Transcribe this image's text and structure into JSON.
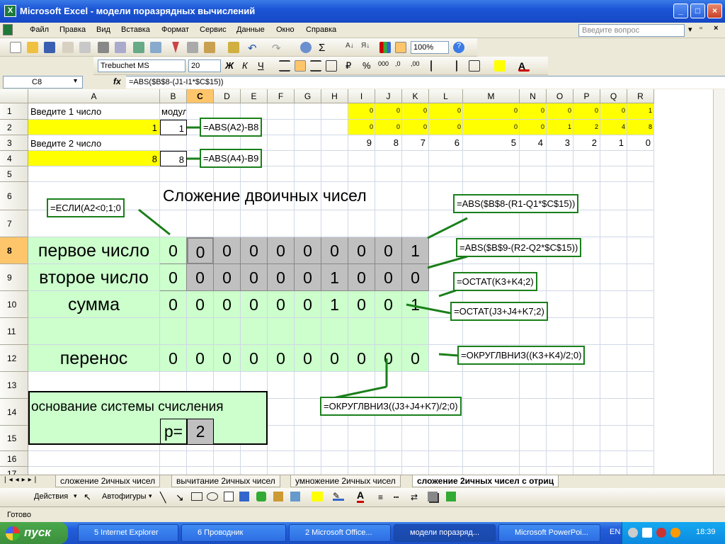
{
  "window": {
    "title": "Microsoft Excel - модели поразрядных вычислений"
  },
  "menu": {
    "items": [
      "Файл",
      "Правка",
      "Вид",
      "Вставка",
      "Формат",
      "Сервис",
      "Данные",
      "Окно",
      "Справка"
    ],
    "help_placeholder": "Введите вопрос"
  },
  "toolbar": {
    "zoom": "100%",
    "font_name": "Trebuchet MS",
    "font_size": "20"
  },
  "formula_bar": {
    "name_box": "C8",
    "fx": "fx",
    "formula": "=ABS($B$8-(J1-I1*$C$15))"
  },
  "columns": [
    "A",
    "B",
    "C",
    "D",
    "E",
    "F",
    "G",
    "H",
    "I",
    "J",
    "K",
    "L",
    "M",
    "N",
    "O",
    "P",
    "Q",
    "R"
  ],
  "rows": [
    "1",
    "2",
    "3",
    "4",
    "5",
    "6",
    "7",
    "8",
    "9",
    "10",
    "11",
    "12",
    "13",
    "14",
    "15",
    "16",
    "17"
  ],
  "cells": {
    "a1": "Введите 1 число",
    "b1": "модуль",
    "a2": "1",
    "b2": "1",
    "a3": "Введите 2 число",
    "a4": "8",
    "b4": "8",
    "title": "Сложение двоичных чисел",
    "row1_I_R": [
      "0",
      "0",
      "0",
      "0",
      "0",
      "0",
      "0",
      "0",
      "0",
      "1"
    ],
    "row2_I_R": [
      "0",
      "0",
      "0",
      "0",
      "0",
      "0",
      "1",
      "2",
      "4",
      "8"
    ],
    "row3_I_R": [
      "9",
      "8",
      "7",
      "6",
      "5",
      "4",
      "3",
      "2",
      "1",
      "0"
    ],
    "first_label": "первое число",
    "second_label": "второе число",
    "sum_label": "сумма",
    "carry_label": "перенос",
    "row8": [
      "0",
      "0",
      "0",
      "0",
      "0",
      "0",
      "0",
      "0",
      "0",
      "1"
    ],
    "row9": [
      "0",
      "0",
      "0",
      "0",
      "0",
      "0",
      "1",
      "0",
      "0",
      "0"
    ],
    "row10": [
      "0",
      "0",
      "0",
      "0",
      "0",
      "0",
      "1",
      "0",
      "0",
      "1"
    ],
    "row12": [
      "0",
      "0",
      "0",
      "0",
      "0",
      "0",
      "0",
      "0",
      "0",
      "0"
    ],
    "base_label": "основание системы счисления",
    "p_label": "p=",
    "p_value": "2"
  },
  "notes": {
    "n1": "=ABS(A2)-B8",
    "n2": "=ABS(A4)-B9",
    "n3": "=ЕСЛИ(A2<0;1;0",
    "n4": "=ABS($B$8-(R1-Q1*$C$15))",
    "n5": "=ABS($B$9-(R2-Q2*$C$15))",
    "n6": "=ОСТАТ(K3+K4;2)",
    "n7": "=ОСТАТ(J3+J4+K7;2)",
    "n8": "=ОКРУГЛВНИЗ((K3+K4)/2;0)",
    "n9": "=ОКРУГЛВНИЗ((J3+J4+K7)/2;0)"
  },
  "sheets": [
    "сложение 2ичных чисел",
    "вычитание 2ичных чисел",
    "умножение 2ичных чисел",
    "сложение 2ичных чисел с отриц"
  ],
  "drawing": {
    "actions": "Действия",
    "autoshapes": "Автофигуры"
  },
  "status": "Готово",
  "taskbar": {
    "start": "пуск",
    "tasks": [
      "5 Internet Explorer",
      "6 Проводник",
      "2 Microsoft Office...",
      "модели поразряд...",
      "Microsoft PowerPoi..."
    ],
    "lang": "EN",
    "clock": "18:39"
  }
}
